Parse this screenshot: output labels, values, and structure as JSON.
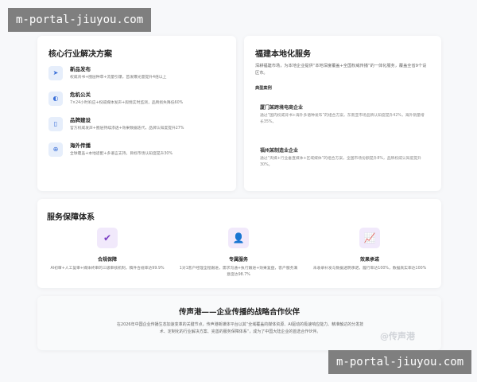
{
  "watermarks": {
    "site": "m-portal-jiuyou.com",
    "brand": "@传声港"
  },
  "solutions": {
    "title": "核心行业解决方案",
    "items": [
      {
        "icon": "rocket-icon",
        "glyph": "➤",
        "title": "新品发布",
        "desc": "权威背书+圈层种草+流量引爆，首发曝光量提升4倍以上"
      },
      {
        "icon": "shield-icon",
        "glyph": "◐",
        "title": "危机公关",
        "desc": "7×24小时响应+权威媒体发声+舆情实时监测，品牌损失降低60%"
      },
      {
        "icon": "bookmark-icon",
        "glyph": "▯",
        "title": "品牌建设",
        "desc": "官方权威发声+圈层持续渗透+效果数据迭代，品牌认知度提升27%"
      },
      {
        "icon": "globe-icon",
        "glyph": "⊕",
        "title": "海外传播",
        "desc": "全球覆盖+本地适配+多语言支持，目标市场认知度提升30%"
      }
    ]
  },
  "local": {
    "title": "福建本地化服务",
    "intro": "深耕福建市场，为本地企业提供“本地深度覆盖+全国权威传播”的一体化服务，覆盖全省9个设区市。",
    "cases_label": "典型案例",
    "cases": [
      {
        "title": "厦门某跨境电商企业",
        "desc": "通过“国内权威背书+海外多语种发布”的组合方案，东南亚市场品牌认知度提升42%，海外销量增长35%。"
      },
      {
        "title": "福州某制造业企业",
        "desc": "通过“央媒+行业垂直媒体+区域媒体”的组合方案，全国市场份额提升8%，品牌权威认知度提升30%。"
      }
    ]
  },
  "services": {
    "title": "服务保障体系",
    "items": [
      {
        "icon": "double-check-icon",
        "glyph": "✔",
        "title": "合规保障",
        "desc": "AI初审+人工复审+媒体终审的三级审核机制，稿件合规率达99.9%"
      },
      {
        "icon": "person-icon",
        "glyph": "👤",
        "title": "专属服务",
        "desc": "1对1客户经理全程跟进，需求沟通+执行跟进+效果复盘，客户服务满意度达98.7%"
      },
      {
        "icon": "line-chart-icon",
        "glyph": "📈",
        "title": "效果承诺",
        "desc": "未收录补发与数据透明承诺，履行率达100%，数据真实率达100%"
      }
    ]
  },
  "partner": {
    "title": "传声港——企业传播的战略合作伙伴",
    "desc": "在2026年中国企业传播生态加速变革的关键节点，传声港新媒体平台以其“全域覆盖的媒体资源、AI驱动的极速响应能力、精准触达的分发技术、定制化的行业解决方案、完善的服务保障体系”，成为了中国大陆企业的首选合作伙伴。"
  }
}
